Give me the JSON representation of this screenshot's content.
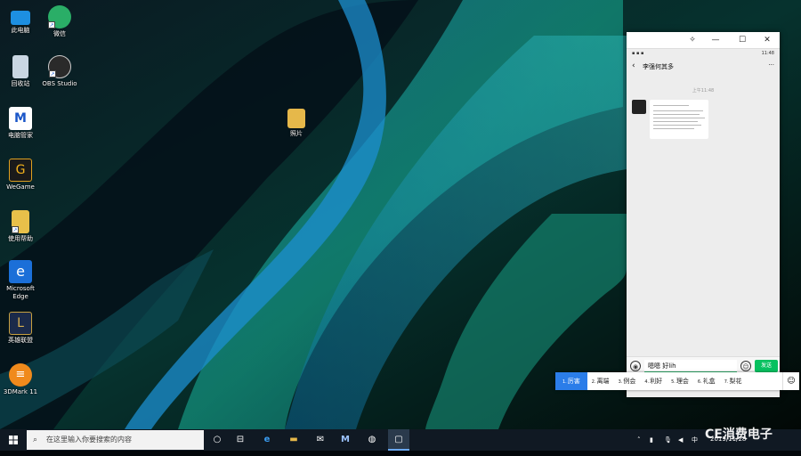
{
  "desktop_icons": [
    {
      "label": "此电脑",
      "icon": "computer-icon"
    },
    {
      "label": "微信",
      "icon": "wechat-icon"
    },
    {
      "label": "回收站",
      "icon": "recycle-bin-icon"
    },
    {
      "label": "OBS Studio",
      "icon": "obs-icon"
    },
    {
      "label": "电脑管家",
      "icon": "pc-manager-icon"
    },
    {
      "label": "WeGame",
      "icon": "wegame-icon"
    },
    {
      "label": "使用帮助",
      "icon": "help-doc-icon"
    },
    {
      "label": "Microsoft Edge",
      "icon": "edge-icon"
    },
    {
      "label": "英雄联盟",
      "icon": "lol-icon"
    },
    {
      "label": "3DMark 11",
      "icon": "3dmark-icon"
    },
    {
      "label": "照片",
      "icon": "folder-icon"
    }
  ],
  "phone": {
    "status_time": "11:48",
    "chat_title": "李强何其多",
    "more": "···",
    "timestamp": "上午11:48",
    "input_text": "嗯嗯 好lih",
    "send_label": "发送"
  },
  "ime": {
    "candidates": [
      {
        "num": "1.",
        "text": "厉害"
      },
      {
        "num": "2.",
        "text": "离端"
      },
      {
        "num": "3.",
        "text": "例会"
      },
      {
        "num": "4.",
        "text": "利好"
      },
      {
        "num": "5.",
        "text": "理会"
      },
      {
        "num": "6.",
        "text": "礼盒"
      },
      {
        "num": "7.",
        "text": "梨花"
      }
    ],
    "emoji_label": "☺"
  },
  "taskbar": {
    "search_placeholder": "在这里输入你要搜索的内容",
    "tray_ime": "中",
    "tray_date": "2019/11/28",
    "watermark": "CE消费电子"
  },
  "colors": {
    "accent": "#2b7de9",
    "wechat_green": "#07c160",
    "taskbar": "#101923"
  }
}
